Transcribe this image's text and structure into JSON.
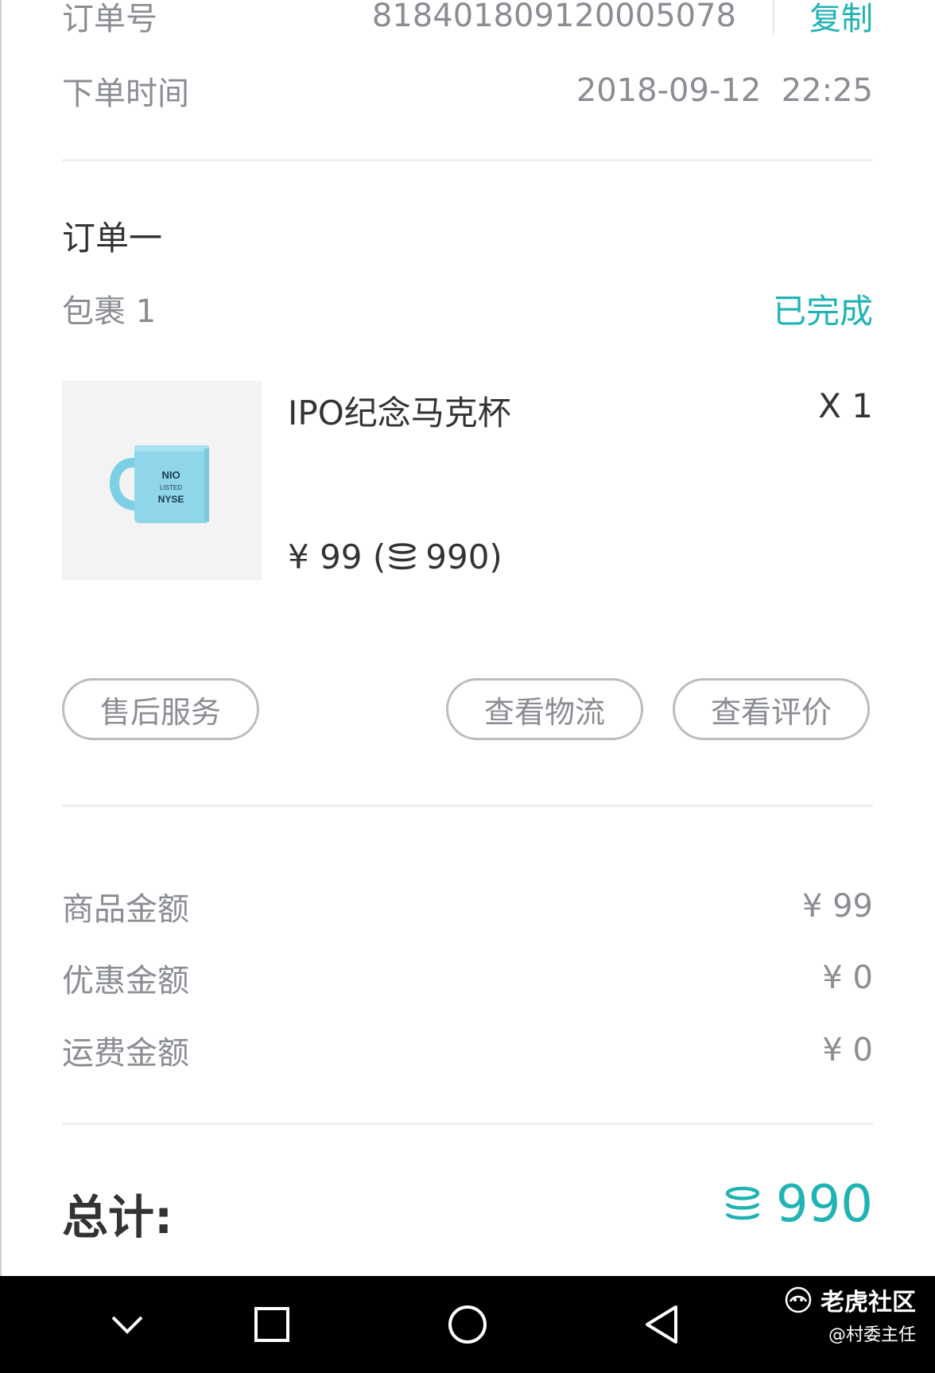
{
  "order_info": {
    "order_no_label": "订单号",
    "order_no": "818401809120005078",
    "copy_label": "复制",
    "time_label": "下单时间",
    "time_value": "2018-09-12  22:25"
  },
  "order": {
    "title": "订单一",
    "package_label": "包裹 1",
    "status": "已完成"
  },
  "product": {
    "name": "IPO纪念马克杯",
    "qty": "X 1",
    "price_prefix": "¥ 99 (",
    "price_points": "990)",
    "mug_text": [
      "NIO",
      "LISTED",
      "NYSE"
    ]
  },
  "actions": {
    "after_sales": "售后服务",
    "logistics": "查看物流",
    "review": "查看评价"
  },
  "summary": {
    "goods_label": "商品金额",
    "goods_value": "¥ 99",
    "discount_label": "优惠金额",
    "discount_value": "¥ 0",
    "shipping_label": "运费金额",
    "shipping_value": "¥ 0"
  },
  "total": {
    "label": "总计:",
    "value": "990"
  },
  "watermark": {
    "brand": "老虎社区",
    "user": "@村委主任"
  },
  "colors": {
    "accent": "#1fb3b3",
    "text_gray": "#8a8d93",
    "text_dark": "#333333"
  }
}
